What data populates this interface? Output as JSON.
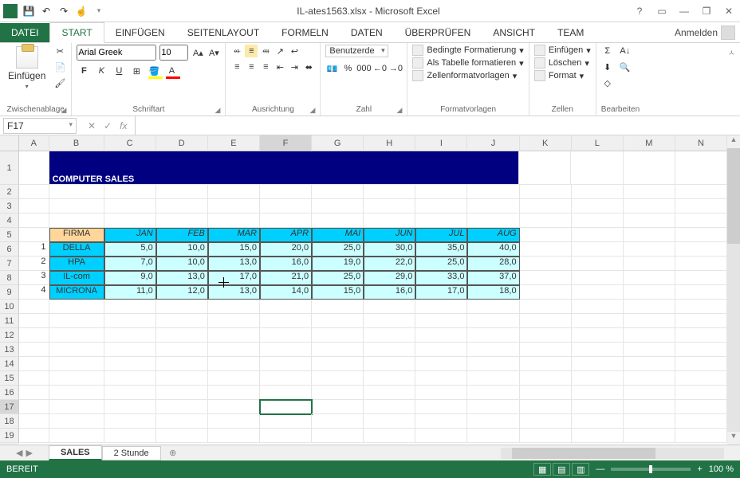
{
  "window": {
    "title": "IL-ates1563.xlsx - Microsoft Excel"
  },
  "qat": {
    "save": "💾",
    "undo": "↶",
    "redo": "↷",
    "touch": "☝"
  },
  "title_controls": {
    "help": "?",
    "ribbon_opts": "▭",
    "min": "—",
    "restore": "❐",
    "close": "✕"
  },
  "tabs": {
    "file": "DATEI",
    "home": "START",
    "insert": "EINFÜGEN",
    "layout": "SEITENLAYOUT",
    "formulas": "FORMELN",
    "data": "DATEN",
    "review": "ÜBERPRÜFEN",
    "view": "ANSICHT",
    "team": "Team"
  },
  "account": {
    "label": "Anmelden"
  },
  "ribbon": {
    "clipboard": {
      "paste": "Einfügen",
      "label": "Zwischenablage"
    },
    "font": {
      "name": "Arial Greek",
      "size": "10",
      "bold": "F",
      "italic": "K",
      "underline": "U",
      "label": "Schriftart"
    },
    "alignment": {
      "label": "Ausrichtung"
    },
    "number": {
      "format": "Benutzerde",
      "label": "Zahl"
    },
    "styles": {
      "cond": "Bedingte Formatierung",
      "table": "Als Tabelle formatieren",
      "cell": "Zellenformatvorlagen",
      "label": "Formatvorlagen"
    },
    "cells": {
      "insert": "Einfügen",
      "delete": "Löschen",
      "format": "Format",
      "label": "Zellen"
    },
    "editing": {
      "label": "Bearbeiten"
    }
  },
  "name_box": "F17",
  "fx": "fx",
  "columns": [
    "A",
    "B",
    "C",
    "D",
    "E",
    "F",
    "G",
    "H",
    "I",
    "J",
    "K",
    "L",
    "M",
    "N"
  ],
  "rows": [
    "1",
    "2",
    "3",
    "4",
    "5",
    "6",
    "7",
    "8",
    "9",
    "10",
    "11",
    "12",
    "13",
    "14",
    "15",
    "16",
    "17",
    "18",
    "19"
  ],
  "sheet": {
    "title": "COMPUTER SALES",
    "header": [
      "FIRMA",
      "JAN",
      "FEB",
      "MAR",
      "APR",
      "MAI",
      "JUN",
      "JUL",
      "AUG"
    ],
    "idx": [
      "1",
      "2",
      "3",
      "4"
    ],
    "firms": [
      "DELLA",
      "HPA",
      "IL-com",
      "MICRONA"
    ],
    "data": [
      [
        "5,0",
        "10,0",
        "15,0",
        "20,0",
        "25,0",
        "30,0",
        "35,0",
        "40,0"
      ],
      [
        "7,0",
        "10,0",
        "13,0",
        "16,0",
        "19,0",
        "22,0",
        "25,0",
        "28,0"
      ],
      [
        "9,0",
        "13,0",
        "17,0",
        "21,0",
        "25,0",
        "29,0",
        "33,0",
        "37,0"
      ],
      [
        "11,0",
        "12,0",
        "13,0",
        "14,0",
        "15,0",
        "16,0",
        "17,0",
        "18,0"
      ]
    ]
  },
  "sheet_tabs": {
    "active": "SALES",
    "other": "2 Stunde"
  },
  "status": {
    "ready": "BEREIT",
    "zoom": "100 %"
  }
}
